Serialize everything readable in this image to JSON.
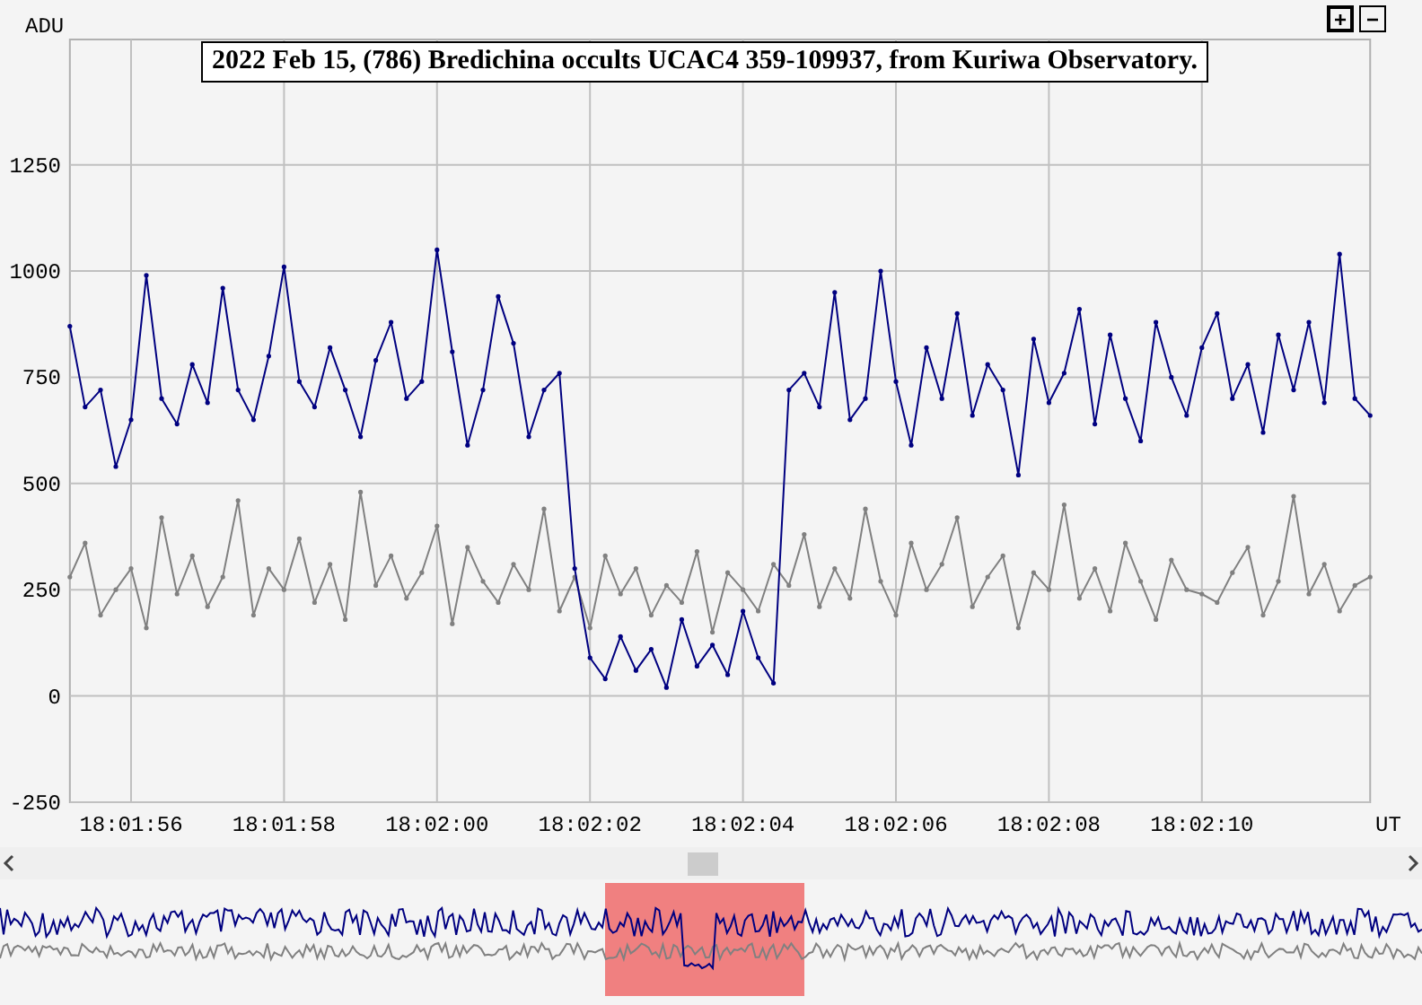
{
  "title": "2022 Feb 15, (786) Bredichina occults UCAC4 359-109937, from Kuriwa Observatory.",
  "zoom_buttons": [
    "+",
    "−"
  ],
  "chart": {
    "chart_data": {
      "type": "line",
      "xlabel": "UT",
      "ylabel": "ADU",
      "ylim": [
        -250,
        1545
      ],
      "grid": true,
      "yticks": [
        -250,
        0,
        250,
        500,
        750,
        1000,
        1250
      ],
      "categories": [
        null,
        null,
        null,
        null,
        "18:01:56",
        null,
        null,
        null,
        null,
        null,
        null,
        null,
        null,
        null,
        "18:01:58",
        null,
        null,
        null,
        null,
        null,
        null,
        null,
        null,
        null,
        "18:02:00",
        null,
        null,
        null,
        null,
        null,
        null,
        null,
        null,
        null,
        "18:02:02",
        null,
        null,
        null,
        null,
        null,
        null,
        null,
        null,
        null,
        "18:02:04",
        null,
        null,
        null,
        null,
        null,
        null,
        null,
        null,
        null,
        "18:02:06",
        null,
        null,
        null,
        null,
        null,
        null,
        null,
        null,
        null,
        "18:02:08",
        null,
        null,
        null,
        null,
        null,
        null,
        null,
        null,
        null,
        "18:02:10",
        null,
        null,
        null,
        null,
        null,
        null,
        null,
        null,
        null,
        null,
        null
      ],
      "series": [
        {
          "color": "#000080",
          "values": [
            870,
            680,
            720,
            540,
            650,
            990,
            700,
            640,
            780,
            690,
            960,
            720,
            650,
            800,
            1010,
            740,
            680,
            820,
            720,
            610,
            790,
            880,
            700,
            740,
            1050,
            810,
            590,
            720,
            940,
            830,
            610,
            720,
            760,
            300,
            90,
            40,
            140,
            60,
            110,
            20,
            180,
            70,
            120,
            50,
            200,
            90,
            30,
            720,
            760,
            680,
            950,
            650,
            700,
            1000,
            740,
            590,
            820,
            700,
            900,
            660,
            780,
            720,
            520,
            840,
            690,
            760,
            910,
            640,
            850,
            700,
            600,
            880,
            750,
            660,
            820,
            900,
            700,
            780,
            620,
            850,
            720,
            880,
            690,
            1040,
            700,
            660
          ]
        },
        {
          "color": "#808080",
          "values": [
            280,
            360,
            190,
            250,
            300,
            160,
            420,
            240,
            330,
            210,
            280,
            460,
            190,
            300,
            250,
            370,
            220,
            310,
            180,
            480,
            260,
            330,
            230,
            290,
            400,
            170,
            350,
            270,
            220,
            310,
            250,
            440,
            200,
            280,
            160,
            330,
            240,
            300,
            190,
            260,
            220,
            340,
            150,
            290,
            250,
            200,
            310,
            260,
            380,
            210,
            300,
            230,
            440,
            270,
            190,
            360,
            250,
            310,
            420,
            210,
            280,
            330,
            160,
            290,
            250,
            450,
            230,
            300,
            200,
            360,
            270,
            180,
            320,
            250,
            240,
            220,
            290,
            350,
            190,
            270,
            470,
            240,
            310,
            200,
            260,
            280
          ]
        }
      ]
    }
  }
}
